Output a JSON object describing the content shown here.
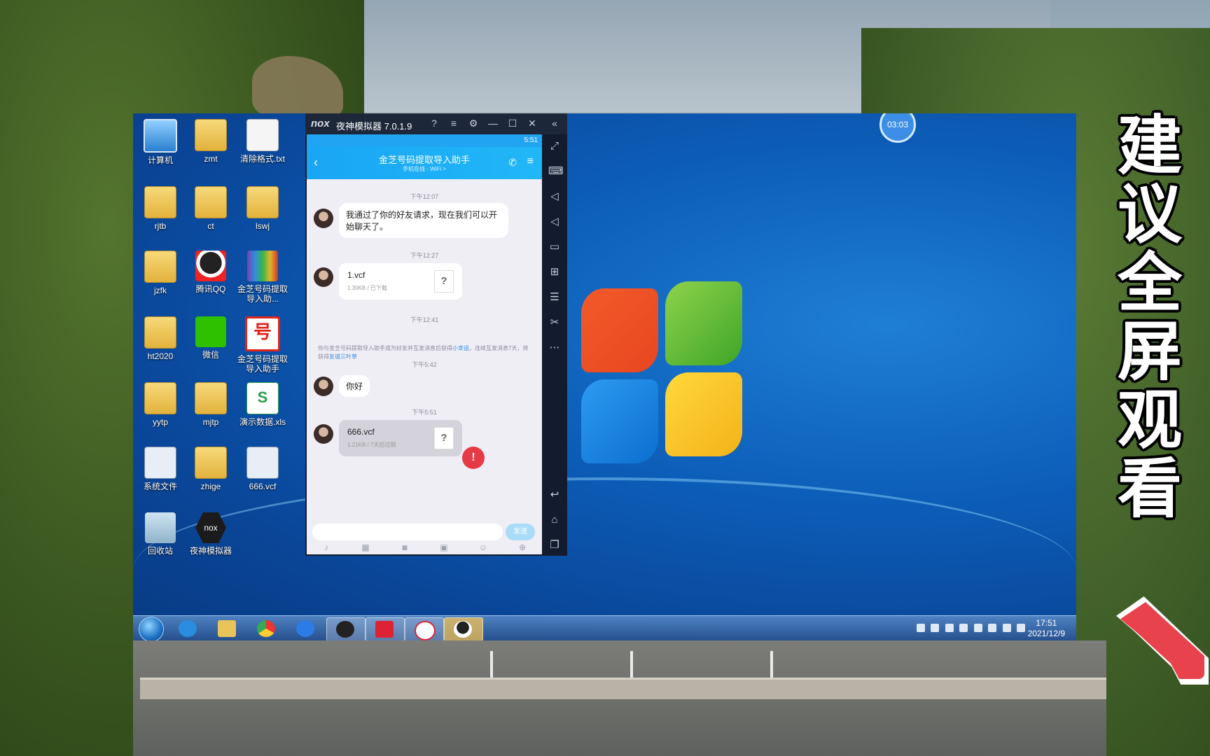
{
  "desktop": {
    "icons": [
      {
        "label": "计算机"
      },
      {
        "label": "zmt"
      },
      {
        "label": "清除格式.txt"
      },
      {
        "label": "rjtb"
      },
      {
        "label": "ct"
      },
      {
        "label": "lswj"
      },
      {
        "label": "jzfk"
      },
      {
        "label": "腾讯QQ"
      },
      {
        "label": "金芝号码提取导入助..."
      },
      {
        "label": "ht2020"
      },
      {
        "label": "微信"
      },
      {
        "label": "金芝号码提取导入助手"
      },
      {
        "label": "yytp"
      },
      {
        "label": "mjtp"
      },
      {
        "label": "演示数据.xls"
      },
      {
        "label": "系统文件"
      },
      {
        "label": "zhige"
      },
      {
        "label": "666.vcf"
      },
      {
        "label": "回收站"
      },
      {
        "label": "夜神模拟器"
      }
    ],
    "timer": "03:03",
    "hao_glyph": "号",
    "xls_glyph": "S",
    "nox_glyph": "nox"
  },
  "taskbar": {
    "clock_time": "17:51",
    "clock_date": "2021/12/9"
  },
  "nox": {
    "logo": "nox",
    "title": "夜神模拟器 7.0.1.9",
    "controls": [
      "?",
      "≡",
      "⚙",
      "—",
      "☐",
      "✕",
      "«"
    ]
  },
  "phone": {
    "status_time": "5:51",
    "chat_title": "金芝号码提取导入助手",
    "chat_subtitle": "手机在线 - WiFi >",
    "messages": {
      "ts1": "下午12:07",
      "m1": "我通过了你的好友请求，现在我们可以开始聊天了。",
      "ts2": "下午12:27",
      "file1_name": "1.vcf",
      "file1_meta": "1.30KB / 已下载",
      "ts3": "下午12:41",
      "notice_a": "你与金芝号码提取导入助手成为好友并互发消息后获得",
      "notice_b": "小幸运",
      "notice_c": "，连续互发消息7天，将获得",
      "notice_d": "友谊三叶草",
      "ts4": "下午5:42",
      "m2": "你好",
      "ts5": "下午5:51",
      "file2_name": "666.vcf",
      "file2_meta": "1.21KB / 7天后过期",
      "file_q": "?",
      "error_mark": "!"
    },
    "send_label": "发送"
  },
  "caption": [
    "建",
    "议",
    "全",
    "屏",
    "观",
    "看"
  ]
}
